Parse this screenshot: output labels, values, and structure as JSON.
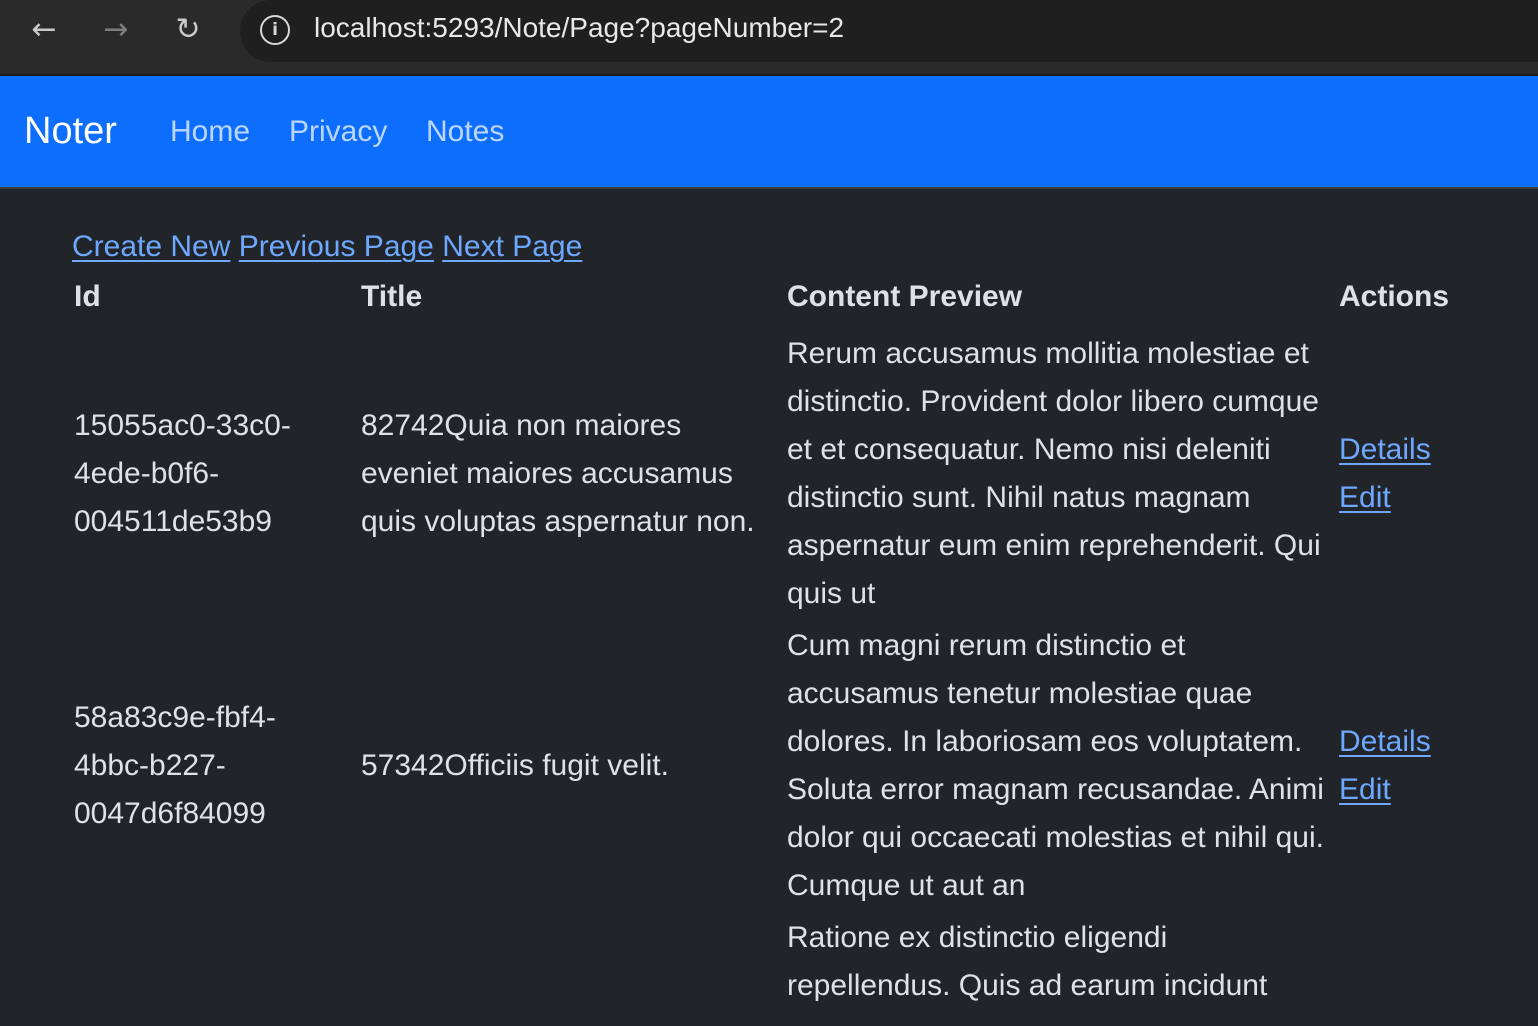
{
  "browser": {
    "url": "localhost:5293/Note/Page?pageNumber=2",
    "back_icon": "←",
    "forward_icon": "→",
    "reload_icon": "↻",
    "info_icon": "i"
  },
  "navbar": {
    "brand": "Noter",
    "links": [
      "Home",
      "Privacy",
      "Notes"
    ],
    "background": "#0d6efd"
  },
  "actions": {
    "create_new": "Create New",
    "previous_page": "Previous Page",
    "next_page": "Next Page"
  },
  "table": {
    "headers": [
      "Id",
      "Title",
      "Content Preview",
      "Actions"
    ],
    "rows": [
      {
        "id": "15055ac0-33c0-4ede-b0f6-004511de53b9",
        "title": "82742Quia non maiores eveniet maiores accusamus quis voluptas aspernatur non.",
        "content": "Rerum accusamus mollitia molestiae et distinctio. Provident dolor libero cumque et et consequatur. Nemo nisi deleniti distinctio sunt. Nihil natus magnam aspernatur eum enim reprehenderit. Qui quis ut",
        "details": "Details",
        "edit": "Edit"
      },
      {
        "id": "58a83c9e-fbf4-4bbc-b227-0047d6f84099",
        "title": "57342Officiis fugit velit.",
        "content": "Cum magni rerum distinctio et accusamus tenetur molestiae quae dolores. In laboriosam eos voluptatem. Soluta error magnam recusandae. Animi dolor qui occaecati molestias et nihil qui. Cumque ut aut an",
        "details": "Details",
        "edit": "Edit"
      },
      {
        "id": "",
        "title": "",
        "content": "Ratione ex distinctio eligendi repellendus. Quis ad earum incidunt",
        "details": "",
        "edit": ""
      }
    ]
  },
  "colors": {
    "page_background": "#212529",
    "link": "#6ea8fe",
    "text": "#dee2e6"
  }
}
